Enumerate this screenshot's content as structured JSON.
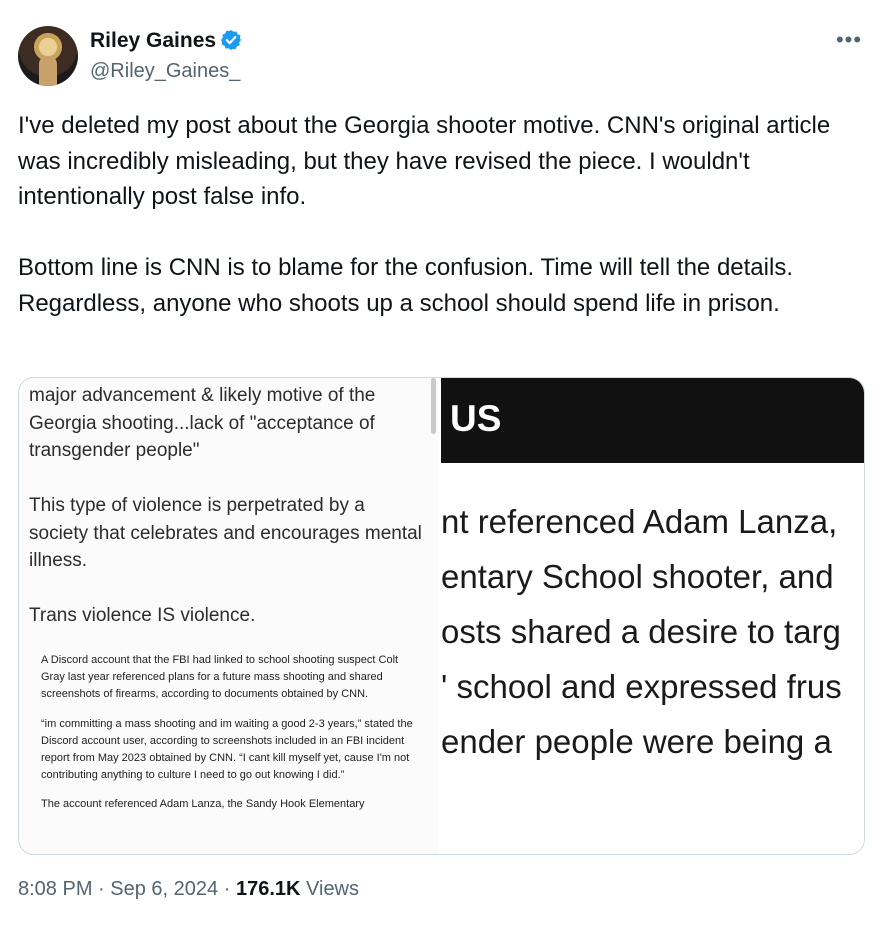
{
  "author": {
    "display_name": "Riley Gaines",
    "handle": "@Riley_Gaines_",
    "verified": true,
    "avatar_icon": "avatar-photo"
  },
  "more_icon": "more-options-icon",
  "tweet": {
    "paragraphs": [
      "I've deleted my post about the Georgia shooter motive. CNN's original article was incredibly misleading, but they have revised the piece. I wouldn't intentionally post false info.",
      "Bottom line is CNN is to blame for the confusion. Time will tell the details.",
      "Regardless, anyone who shoots up a school should spend life in prison."
    ]
  },
  "media": {
    "left": {
      "quote_paragraphs": [
        "major advancement & likely motive of the Georgia shooting...lack of \"acceptance of transgender people\"",
        "This type of violence is perpetrated by a society that celebrates and encourages mental illness.",
        "Trans violence IS violence."
      ],
      "article_paragraphs": [
        "A Discord account that the FBI had linked to school shooting suspect Colt Gray last year referenced plans for a future mass shooting and shared screenshots of firearms, according to documents obtained by CNN.",
        "“im committing a mass shooting and im waiting a good 2-3 years,” stated the Discord account user, according to screenshots included in an FBI incident report from May 2023 obtained by CNN. “I cant kill myself yet, cause I'm not contributing anything to culture I need to go out knowing I did.”",
        "The account referenced Adam Lanza, the Sandy Hook Elementary"
      ]
    },
    "right": {
      "banner_text": "US",
      "lines": [
        "nt referenced Adam Lanza,",
        "entary School shooter, and",
        "osts shared a desire to targ",
        "' school and expressed frus",
        "ender people were being a"
      ]
    }
  },
  "meta": {
    "time": "8:08 PM",
    "separator": "·",
    "date": "Sep 6, 2024",
    "views_count": "176.1K",
    "views_label": "Views"
  },
  "colors": {
    "text": "#0f1419",
    "secondary": "#536471",
    "verified_blue": "#1d9bf0",
    "border": "#cfd9de"
  }
}
